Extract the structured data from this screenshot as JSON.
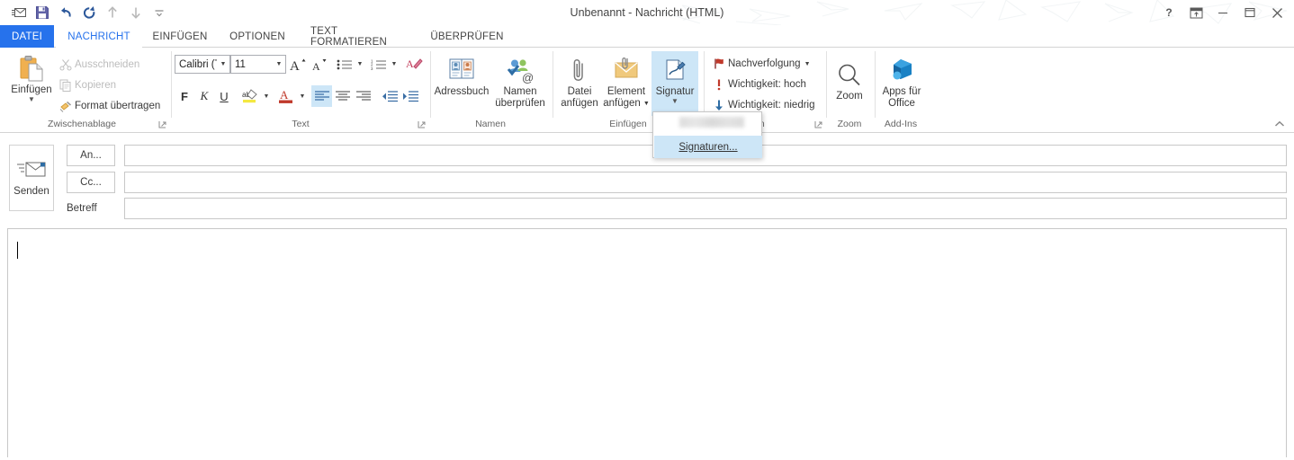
{
  "window": {
    "title": "Unbenannt - Nachricht (HTML)",
    "controls": [
      {
        "name": "help-button",
        "glyph": "?"
      },
      {
        "name": "ribbon-display-options-button",
        "glyph": "▣"
      },
      {
        "name": "minimize-button",
        "glyph": "—"
      },
      {
        "name": "maximize-button",
        "glyph": "▢"
      },
      {
        "name": "close-button",
        "glyph": "✕"
      }
    ]
  },
  "quick_access": [
    {
      "name": "new-email-icon",
      "title": "Neue E-Mail"
    },
    {
      "name": "save-icon",
      "title": "Speichern"
    },
    {
      "name": "undo-icon",
      "title": "Rückgängig"
    },
    {
      "name": "redo-icon",
      "title": "Wiederholen"
    },
    {
      "name": "previous-item-icon",
      "title": "Vorheriges Element"
    },
    {
      "name": "next-item-icon",
      "title": "Nächstes Element"
    },
    {
      "name": "customize-qat-icon",
      "title": "Symbolleiste anpassen"
    }
  ],
  "tabs": [
    {
      "label": "DATEI",
      "state": "file"
    },
    {
      "label": "NACHRICHT",
      "state": "active"
    },
    {
      "label": "EINFÜGEN",
      "state": "normal"
    },
    {
      "label": "OPTIONEN",
      "state": "normal"
    },
    {
      "label": "TEXT FORMATIEREN",
      "state": "normal"
    },
    {
      "label": "ÜBERPRÜFEN",
      "state": "normal"
    }
  ],
  "ribbon": {
    "collapse_label": "⌃",
    "groups": {
      "clipboard": {
        "label": "Zwischenablage",
        "paste": "Einfügen",
        "cut": "Ausschneiden",
        "copy": "Kopieren",
        "format_painter": "Format übertragen"
      },
      "text": {
        "label": "Text",
        "font_name": "Calibri (T",
        "font_size": "11",
        "grow_font": "A",
        "shrink_font": "A",
        "bold": "F",
        "italic": "K",
        "underline": "U"
      },
      "names": {
        "label": "Namen",
        "address_book": "Adressbuch",
        "check_names_line1": "Namen",
        "check_names_line2": "überprüfen"
      },
      "include": {
        "label": "Einfügen",
        "attach_file_line1": "Datei",
        "attach_file_line2": "anfügen",
        "attach_item_line1": "Element",
        "attach_item_line2": "anfügen",
        "signature": "Signatur"
      },
      "tags": {
        "label": "rien",
        "follow_up": "Nachverfolgung",
        "high_importance": "Wichtigkeit: hoch",
        "low_importance": "Wichtigkeit: niedrig"
      },
      "zoom": {
        "label": "Zoom",
        "button": "Zoom"
      },
      "addins": {
        "label": "Add-Ins",
        "apps_line1": "Apps für",
        "apps_line2": "Office"
      }
    }
  },
  "signature_menu": {
    "redacted_item": "",
    "signatures_item": "Signaturen..."
  },
  "compose": {
    "send_button": "Senden",
    "to_button": "An...",
    "cc_button": "Cc...",
    "subject_label": "Betreff",
    "to_value": "",
    "cc_value": "",
    "subject_value": "",
    "body_value": ""
  },
  "colors": {
    "accent": "#2672ec",
    "selection": "#cde6f7",
    "hover": "#e5f1fb",
    "border": "#d4d4d4"
  }
}
